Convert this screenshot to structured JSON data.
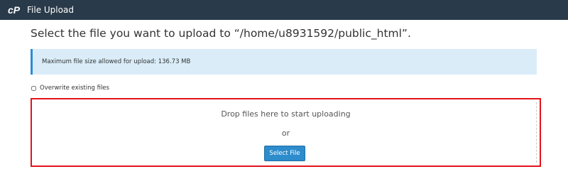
{
  "topbar": {
    "logo_icon": "cpanel-logo-icon",
    "title": "File Upload"
  },
  "main": {
    "heading": "Select the file you want to upload to “/home/u8931592/public_html”.",
    "info_alert": "Maximum file size allowed for upload: 136.73 MB",
    "overwrite": {
      "label": "Overwrite existing files",
      "checked": false
    },
    "dropzone": {
      "drop_text": "Drop files here to start uploading",
      "or_text": "or",
      "button_label": "Select File"
    }
  },
  "colors": {
    "topbar_bg": "#293a4a",
    "alert_bg": "#d9ecf8",
    "alert_border": "#2a8bd6",
    "dropzone_highlight": "#e3131a",
    "button_bg": "#2d8ccc"
  }
}
